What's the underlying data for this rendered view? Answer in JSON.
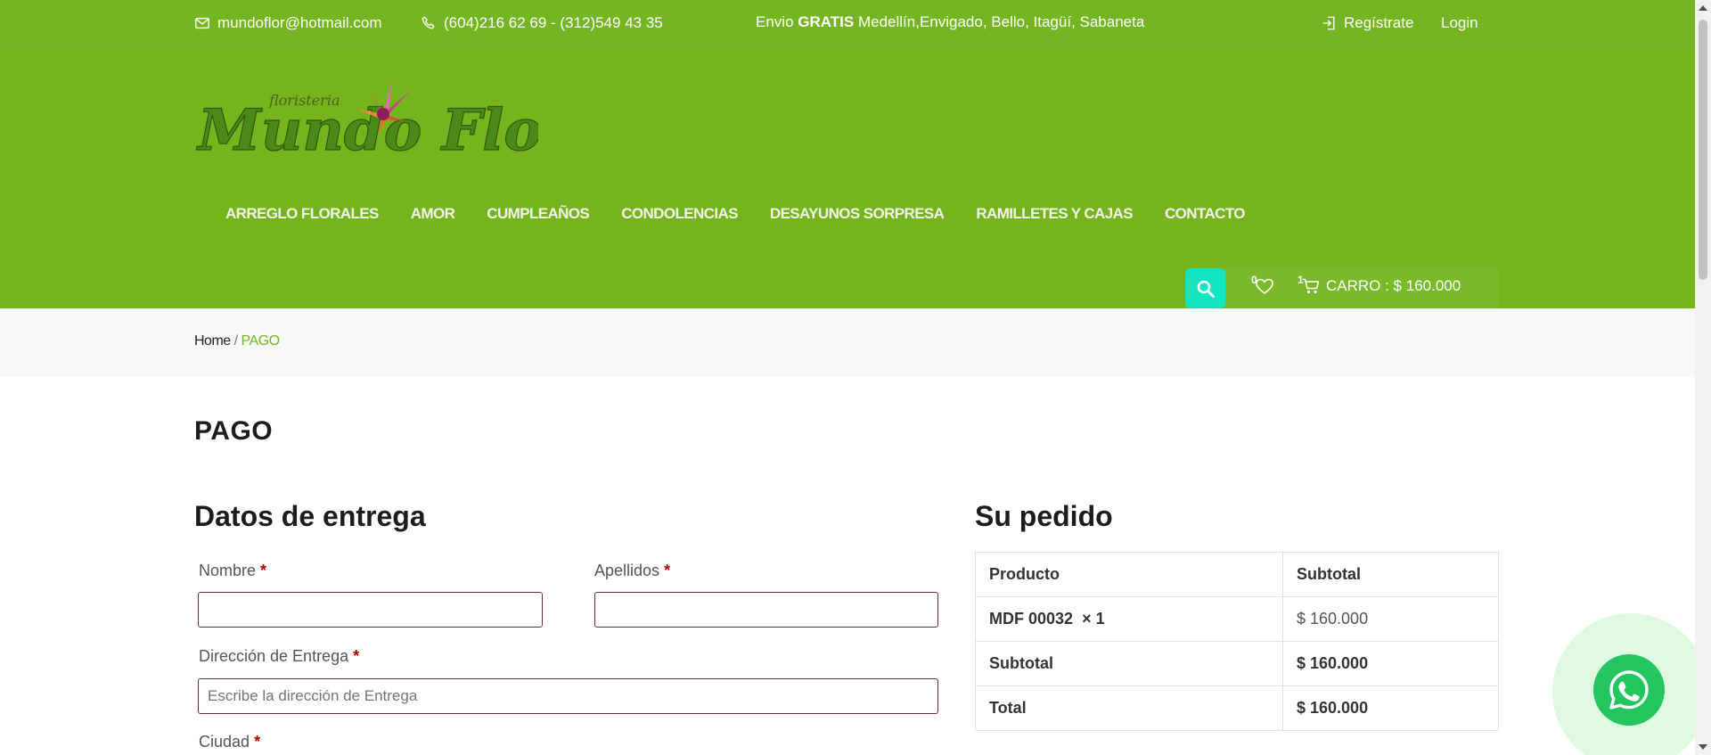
{
  "topbar": {
    "email": "mundoflor@hotmail.com",
    "phone": "(604)216 62 69 - (312)549 43 35",
    "shipping_prefix": "Envio",
    "shipping_bold": "GRATIS",
    "shipping_suffix": "Medellín,Envigado, Bello, Itagüí, Sabaneta",
    "register": "Regístrate",
    "login": "Login"
  },
  "logo": {
    "small_text": "floristeria",
    "brand_text": "Mundo Flor"
  },
  "nav": [
    "ARREGLO FLORALES",
    "AMOR",
    "CUMPLEAÑOS",
    "CONDOLENCIAS",
    "DESAYUNOS SORPRESA",
    "RAMILLETES Y CAJAS",
    "CONTACTO"
  ],
  "tools": {
    "wishlist_count": "0",
    "cart_count": "1",
    "cart_label": "CARRO : $ 160.000"
  },
  "breadcrumb": {
    "home": "Home",
    "sep": " / ",
    "current": "PAGO"
  },
  "page_title": "PAGO",
  "delivery": {
    "title": "Datos de entrega",
    "nombre_label": "Nombre",
    "apellidos_label": "Apellidos",
    "direccion_label": "Dirección de Entrega",
    "direccion_placeholder": "Escribe la dirección de Entrega",
    "ciudad_label": "Ciudad",
    "required_mark": "*"
  },
  "order": {
    "title": "Su pedido",
    "headers": [
      "Producto",
      "Subtotal"
    ],
    "item_name": "MDF 00032",
    "item_qty": "× 1",
    "item_price": "$ 160.000",
    "subtotal_label": "Subtotal",
    "subtotal_value": "$ 160.000",
    "total_label": "Total",
    "total_value": "$ 160.000"
  },
  "colors": {
    "brand_green": "#76b41e",
    "search_teal": "#13e5c0",
    "whatsapp": "#22c55e",
    "required": "#b10000"
  }
}
